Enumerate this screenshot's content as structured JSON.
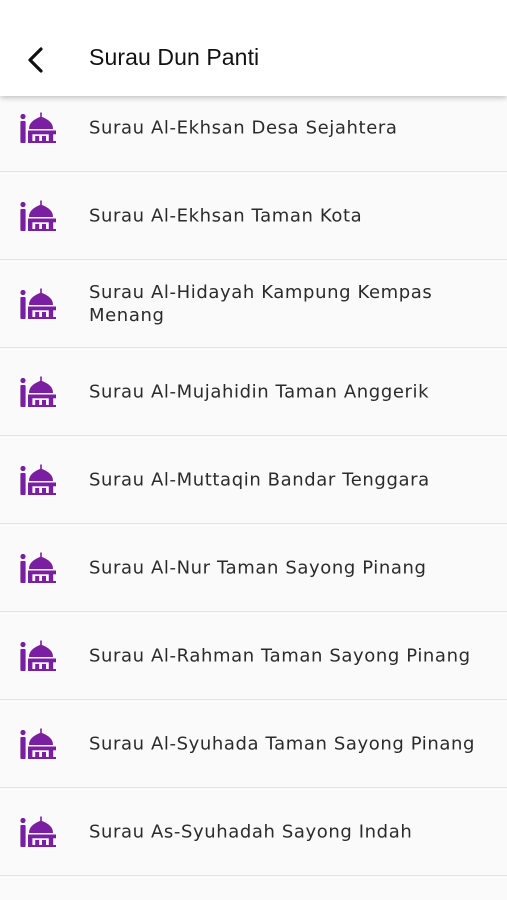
{
  "header": {
    "title": "Surau Dun Panti"
  },
  "icons": {
    "back": "back-arrow-icon",
    "item": "mosque-icon"
  },
  "colors": {
    "accent": "#7b1fa2",
    "text": "#2b2b2b",
    "divider": "#e3e3e3"
  },
  "list": {
    "items": [
      {
        "label": "Surau Al-Ekhsan Desa Sejahtera"
      },
      {
        "label": "Surau Al-Ekhsan Taman Kota"
      },
      {
        "label": "Surau Al-Hidayah Kampung Kempas Menang"
      },
      {
        "label": "Surau Al-Mujahidin Taman Anggerik"
      },
      {
        "label": "Surau Al-Muttaqin Bandar Tenggara"
      },
      {
        "label": "Surau Al-Nur Taman Sayong Pinang"
      },
      {
        "label": "Surau Al-Rahman Taman Sayong Pinang"
      },
      {
        "label": "Surau Al-Syuhada Taman Sayong Pinang"
      },
      {
        "label": "Surau As-Syuhadah Sayong Indah"
      }
    ]
  }
}
